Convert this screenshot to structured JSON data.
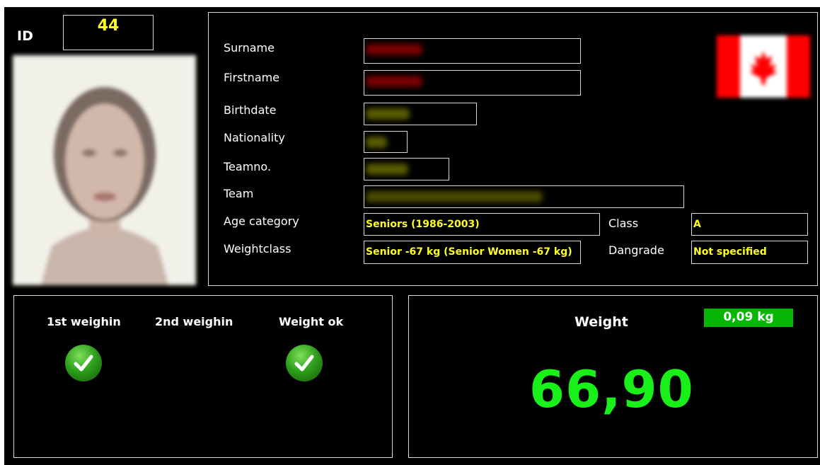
{
  "athlete": {
    "id_label": "ID",
    "id": "44",
    "photo_icon": "athlete-photo",
    "flag_icon": "canada-flag-icon",
    "fields": {
      "surname": {
        "label": "Surname"
      },
      "firstname": {
        "label": "Firstname"
      },
      "birthdate": {
        "label": "Birthdate"
      },
      "nationality": {
        "label": "Nationality"
      },
      "teamno": {
        "label": "Teamno."
      },
      "team": {
        "label": "Team"
      },
      "age_category": {
        "label": "Age category",
        "value": "Seniors (1986-2003)"
      },
      "weightclass": {
        "label": "Weightclass",
        "value": "Senior -67 kg (Senior Women -67 kg)"
      },
      "class": {
        "label": "Class",
        "value": "A"
      },
      "dangrade": {
        "label": "Dangrade",
        "value": "Not specified"
      }
    }
  },
  "weighin": {
    "first": {
      "label": "1st weighin",
      "status": "ok",
      "icon": "checkmark-icon"
    },
    "second": {
      "label": "2nd weighin"
    },
    "weight_ok": {
      "label": "Weight ok",
      "status": "ok",
      "icon": "checkmark-icon"
    }
  },
  "weight": {
    "title": "Weight",
    "difference": "0,09 kg",
    "value": "66,90"
  },
  "colors": {
    "background": "#000000",
    "field_text": "#ffff20",
    "weight_value": "#19f019",
    "difference_badge": "#05b605"
  }
}
